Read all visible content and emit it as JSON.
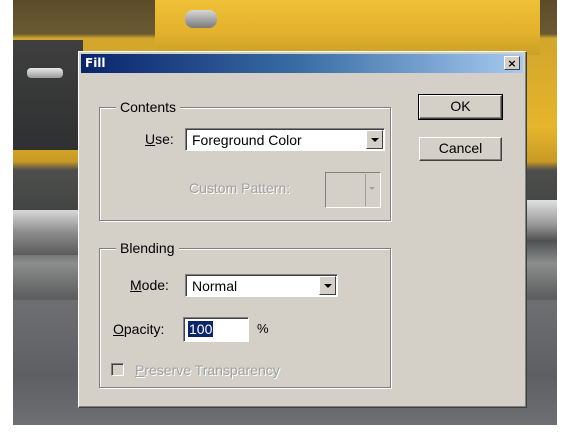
{
  "dialog": {
    "title": "Fill",
    "close_glyph": "×"
  },
  "contents": {
    "legend": "Contents",
    "use_label_prefix": "",
    "use_label_mnemonic": "U",
    "use_label_rest": "se:",
    "use_value": "Foreground Color",
    "custom_pattern_label": "Custom Pattern:"
  },
  "blending": {
    "legend": "Blending",
    "mode_label_mnemonic": "M",
    "mode_label_rest": "ode:",
    "mode_value": "Normal",
    "opacity_label_mnemonic": "O",
    "opacity_label_rest": "pacity:",
    "opacity_value": "100",
    "opacity_unit": "%",
    "preserve_mnemonic": "P",
    "preserve_rest": "reserve Transparency",
    "preserve_checked": false
  },
  "buttons": {
    "ok": "OK",
    "cancel": "Cancel"
  },
  "colors": {
    "dialog_face": "#d4d0c8",
    "titlebar_start": "#0a246a",
    "titlebar_end": "#a6caf0",
    "selection": "#0a246a",
    "disabled_text": "#a0a0a0"
  },
  "icons": {
    "close": "close-icon",
    "dropdown": "chevron-down-icon"
  }
}
